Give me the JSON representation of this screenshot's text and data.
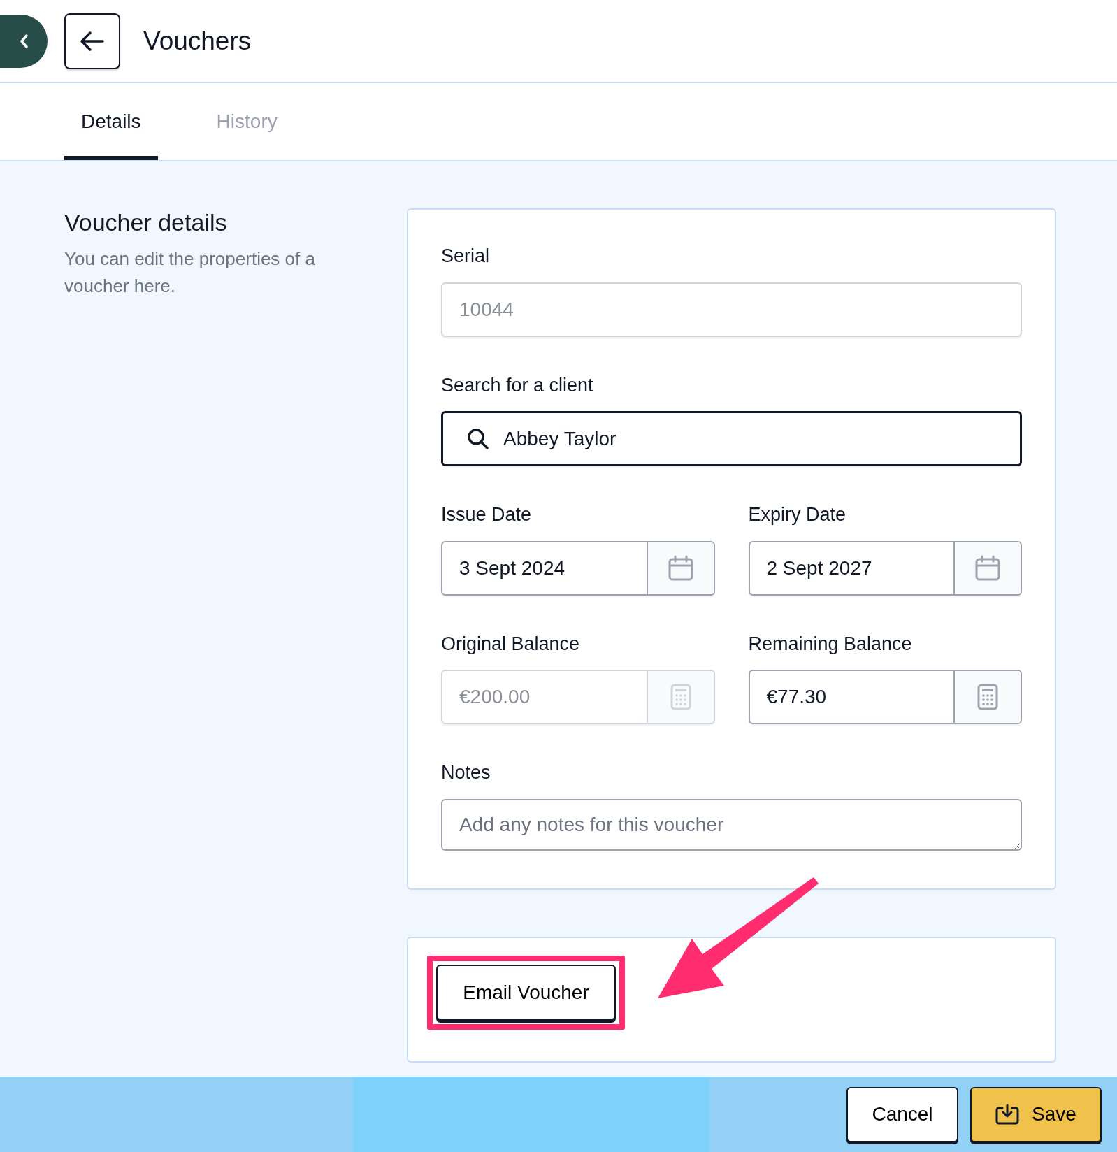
{
  "header": {
    "title": "Vouchers"
  },
  "tabs": [
    {
      "label": "Details",
      "selected": true
    },
    {
      "label": "History",
      "selected": false
    }
  ],
  "section": {
    "title": "Voucher details",
    "description": "You can edit the properties of a voucher here."
  },
  "form": {
    "rows": [
      [
        {
          "kind": "text",
          "label": "Serial",
          "value": "10044",
          "disabled": true
        }
      ],
      [
        {
          "kind": "search",
          "label": "Search for a client",
          "value": "Abbey Taylor",
          "disabled": false
        }
      ],
      [
        {
          "kind": "date",
          "label": "Issue Date",
          "value": "3 Sept 2024",
          "disabled": false
        },
        {
          "kind": "date",
          "label": "Expiry Date",
          "value": "2 Sept 2027",
          "disabled": false
        }
      ],
      [
        {
          "kind": "money",
          "label": "Original Balance",
          "value": "€200.00",
          "disabled": true
        },
        {
          "kind": "money",
          "label": "Remaining Balance",
          "value": "€77.30",
          "disabled": false
        }
      ],
      [
        {
          "kind": "textarea",
          "label": "Notes",
          "placeholder": "Add any notes for this voucher"
        }
      ]
    ]
  },
  "actions_card": {
    "button": "Email Voucher",
    "highlighted": true
  },
  "footer": {
    "buttons": [
      {
        "label": "Cancel",
        "kind": "secondary"
      },
      {
        "label": "Save",
        "kind": "primary"
      }
    ]
  }
}
